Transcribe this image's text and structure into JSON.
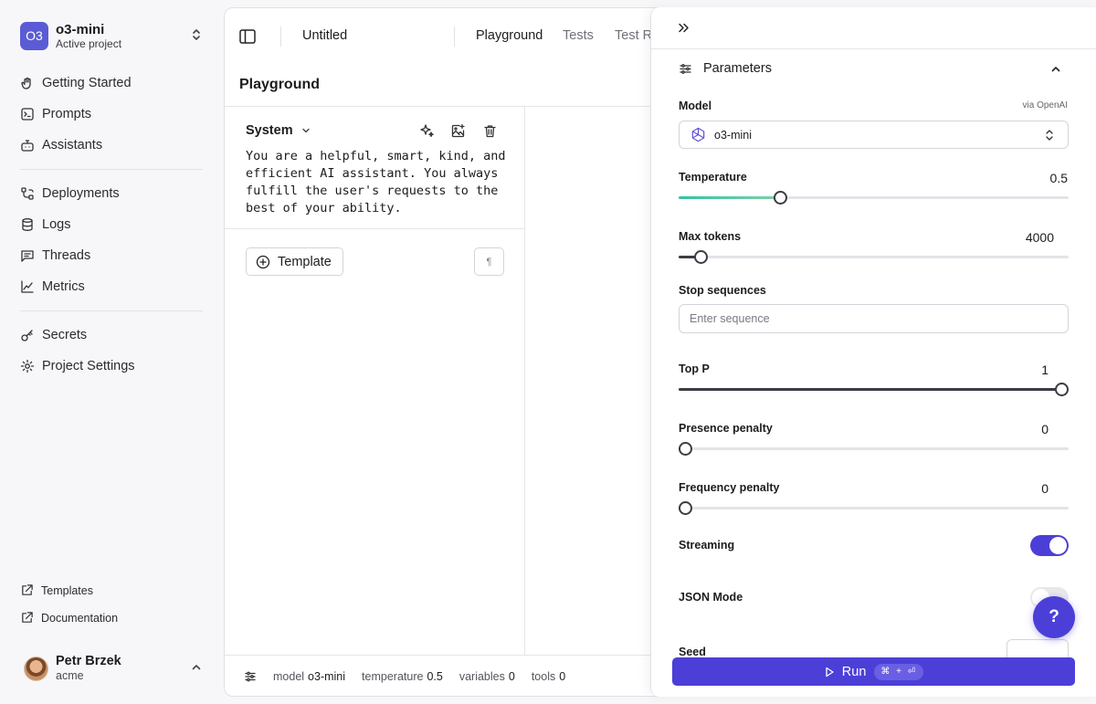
{
  "project": {
    "badge": "O3",
    "name": "o3-mini",
    "subtitle": "Active project"
  },
  "nav": {
    "group1": [
      {
        "label": "Getting Started",
        "icon": "hand-wave-icon"
      },
      {
        "label": "Prompts",
        "icon": "terminal-square-icon"
      },
      {
        "label": "Assistants",
        "icon": "bot-icon"
      }
    ],
    "group2": [
      {
        "label": "Deployments",
        "icon": "branches-icon"
      },
      {
        "label": "Logs",
        "icon": "database-icon"
      },
      {
        "label": "Threads",
        "icon": "message-square-icon"
      },
      {
        "label": "Metrics",
        "icon": "line-chart-icon"
      }
    ],
    "group3": [
      {
        "label": "Secrets",
        "icon": "key-icon"
      },
      {
        "label": "Project Settings",
        "icon": "gear-icon"
      }
    ]
  },
  "footer_links": {
    "templates": "Templates",
    "documentation": "Documentation"
  },
  "user": {
    "name": "Petr Brzek",
    "org": "acme"
  },
  "topbar": {
    "doc_title": "Untitled",
    "tabs": [
      "Playground",
      "Tests",
      "Test R"
    ]
  },
  "playground": {
    "title": "Playground",
    "system_label": "System",
    "system_text": "You are a helpful, smart, kind, and\nefficient AI assistant. You always\nfulfill the user's requests to the\nbest of your ability.",
    "template_button": "Template",
    "pilcrow": "¶"
  },
  "status_bar": {
    "model_key": "model",
    "model_val": "o3-mini",
    "temperature_key": "temperature",
    "temperature_val": "0.5",
    "variables_key": "variables",
    "variables_val": "0",
    "tools_key": "tools",
    "tools_val": "0"
  },
  "params": {
    "title": "Parameters",
    "model_label": "Model",
    "via": "via OpenAI",
    "model_value": "o3-mini",
    "temperature_label": "Temperature",
    "temperature_value": "0.5",
    "temperature_fraction": 0.26,
    "max_tokens_label": "Max tokens",
    "max_tokens_value": "4000",
    "max_tokens_fraction": 0.056,
    "stop_label": "Stop sequences",
    "stop_placeholder": "Enter sequence",
    "top_p_label": "Top P",
    "top_p_value": "1",
    "top_p_fraction": 1.0,
    "presence_label": "Presence penalty",
    "presence_value": "0",
    "presence_fraction": 0.0,
    "frequency_label": "Frequency penalty",
    "frequency_value": "0",
    "frequency_fraction": 0.0,
    "streaming_label": "Streaming",
    "streaming_on": true,
    "json_label": "JSON Mode",
    "json_on": false,
    "seed_label": "Seed"
  },
  "run": {
    "label": "Run",
    "shortcut": "⌘ + ⏎"
  },
  "help": {
    "label": "?"
  },
  "colors": {
    "accent": "#4b3fd8",
    "badge": "#5b5bd6",
    "temp_gradient_start": "#34c3a0"
  }
}
